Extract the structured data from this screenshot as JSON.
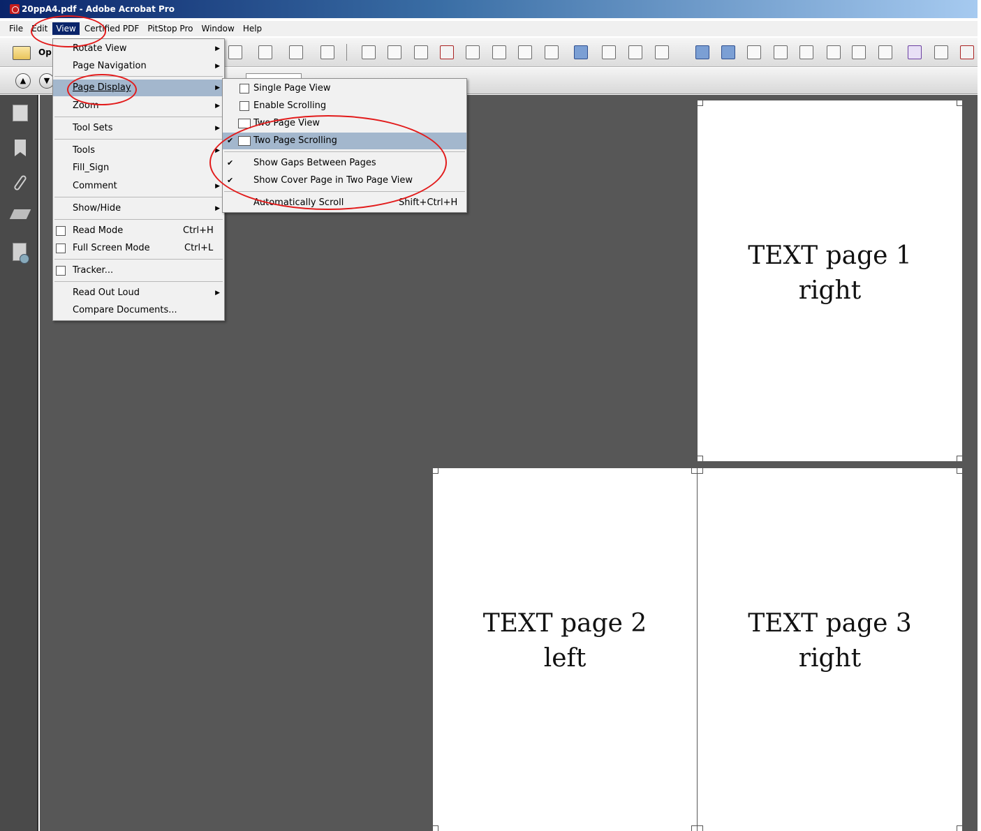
{
  "window": {
    "title": "20ppA4.pdf - Adobe Acrobat Pro"
  },
  "menubar": {
    "items": [
      "File",
      "Edit",
      "View",
      "Certified PDF",
      "PitStop Pro",
      "Window",
      "Help"
    ],
    "active": "View"
  },
  "toolbar": {
    "open_label": "Op"
  },
  "view_menu": {
    "items": [
      {
        "label": "Rotate View",
        "submenu": true
      },
      {
        "label": "Page Navigation",
        "submenu": true
      },
      {
        "label": "Page Display",
        "submenu": true,
        "highlighted": true
      },
      {
        "label": "Zoom",
        "submenu": true
      },
      {
        "label": "Tool Sets",
        "submenu": true
      },
      {
        "label": "Tools",
        "submenu": true
      },
      {
        "label": "Fill_Sign"
      },
      {
        "label": "Comment",
        "submenu": true
      },
      {
        "label": "Show/Hide",
        "submenu": true
      },
      {
        "label": "Read Mode",
        "shortcut": "Ctrl+H"
      },
      {
        "label": "Full Screen Mode",
        "shortcut": "Ctrl+L"
      },
      {
        "label": "Tracker..."
      },
      {
        "label": "Read Out Loud",
        "submenu": true
      },
      {
        "label": "Compare Documents..."
      }
    ]
  },
  "page_display_menu": {
    "items": [
      {
        "label": "Single Page View"
      },
      {
        "label": "Enable Scrolling"
      },
      {
        "label": "Two Page View"
      },
      {
        "label": "Two Page Scrolling",
        "checked": true,
        "highlighted": true
      },
      {
        "label": "Show Gaps Between Pages",
        "checked": true
      },
      {
        "label": "Show Cover Page in Two Page View",
        "checked": true
      },
      {
        "label": "Automatically Scroll",
        "shortcut": "Shift+Ctrl+H"
      }
    ]
  },
  "document": {
    "pages": [
      {
        "line1": "TEXT page 1",
        "line2": "right"
      },
      {
        "line1": "TEXT page 2",
        "line2": "left"
      },
      {
        "line1": "TEXT page 3",
        "line2": "right"
      }
    ]
  },
  "colors": {
    "annotation": "#e21b1b",
    "doc_background": "#575757",
    "menu_highlight": "#a3b7cd"
  }
}
